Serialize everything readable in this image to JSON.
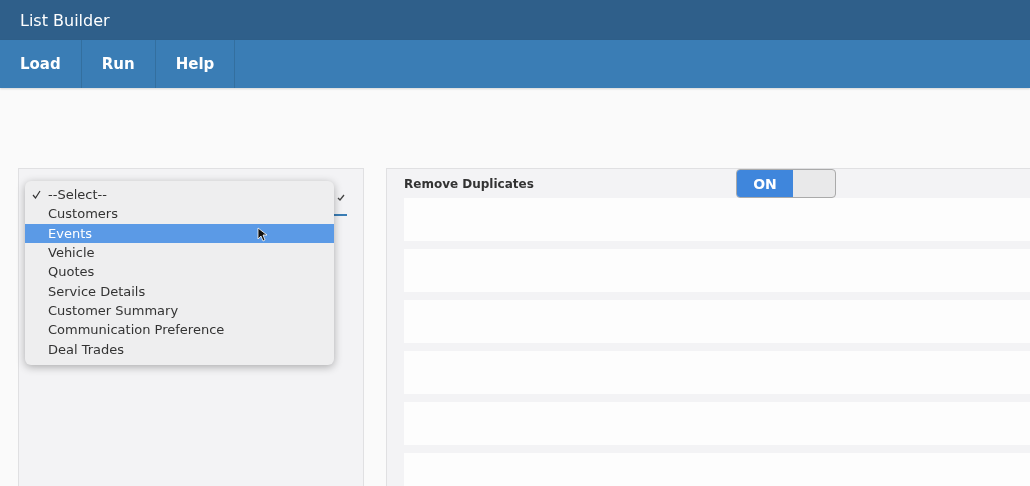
{
  "window": {
    "title": "List Builder"
  },
  "menu": [
    {
      "label": "Load"
    },
    {
      "label": "Run"
    },
    {
      "label": "Help"
    }
  ],
  "list_select": {
    "options": [
      {
        "label": "--Select--",
        "checked": true,
        "highlighted": false
      },
      {
        "label": "Customers",
        "checked": false,
        "highlighted": false
      },
      {
        "label": "Events",
        "checked": false,
        "highlighted": true
      },
      {
        "label": "Vehicle",
        "checked": false,
        "highlighted": false
      },
      {
        "label": "Quotes",
        "checked": false,
        "highlighted": false
      },
      {
        "label": "Service Details",
        "checked": false,
        "highlighted": false
      },
      {
        "label": "Customer Summary",
        "checked": false,
        "highlighted": false
      },
      {
        "label": "Communication Preference",
        "checked": false,
        "highlighted": false
      },
      {
        "label": "Deal Trades",
        "checked": false,
        "highlighted": false
      }
    ]
  },
  "remove_duplicates": {
    "label": "Remove Duplicates",
    "toggle": {
      "text": "ON",
      "on": true
    }
  }
}
